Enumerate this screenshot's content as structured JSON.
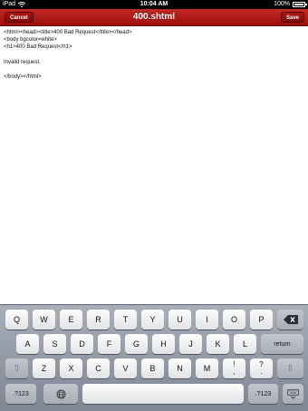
{
  "status_bar": {
    "carrier": "iPad",
    "time": "10:04 AM",
    "battery": "100%"
  },
  "nav": {
    "cancel_label": "Cancel",
    "title": "400.shtml",
    "save_label": "Save"
  },
  "editor": {
    "content": "<html><head><title>400 Bad Request</title></head>\n<body bgcolor=white>\n<h1>400 Bad Request</h1>\n\nInvalid request.\n\n</body></html>"
  },
  "keyboard": {
    "row1": [
      "Q",
      "W",
      "E",
      "R",
      "T",
      "Y",
      "U",
      "I",
      "O",
      "P"
    ],
    "row2": [
      "A",
      "S",
      "D",
      "F",
      "G",
      "H",
      "J",
      "K",
      "L"
    ],
    "row3": [
      "Z",
      "X",
      "C",
      "V",
      "B",
      "N",
      "M"
    ],
    "return_label": "return",
    "punct1": {
      "top": "!",
      "bottom": ","
    },
    "punct2": {
      "top": "?",
      "bottom": "."
    },
    "numbers_label": ".?123",
    "globe_icon": "globe-icon",
    "backspace_icon": "backspace-icon",
    "shift_icon": "shift-icon",
    "dismiss_icon": "keyboard-dismiss-icon"
  }
}
